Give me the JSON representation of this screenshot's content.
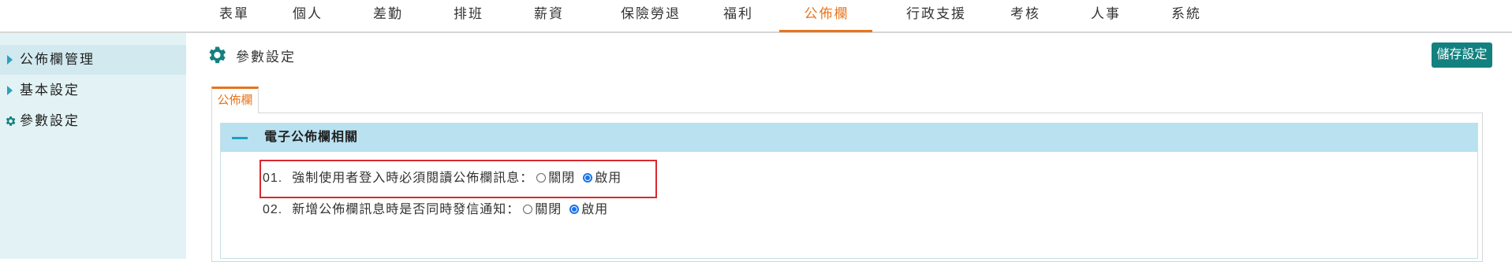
{
  "nav": {
    "items": [
      "表單",
      "個人",
      "差勤",
      "排班",
      "薪資",
      "保險勞退",
      "福利",
      "公佈欄",
      "行政支援",
      "考核",
      "人事",
      "系統"
    ],
    "active": "公佈欄"
  },
  "sidebar": {
    "items": [
      {
        "label": "公佈欄管理",
        "icon": "triangle-right-icon"
      },
      {
        "label": "基本設定",
        "icon": "triangle-right-icon"
      },
      {
        "label": "參數設定",
        "icon": "gear-icon"
      }
    ]
  },
  "page": {
    "title": "參數設定",
    "title_icon": "gear-icon",
    "save_label": "儲存設定"
  },
  "tabs": [
    {
      "label": "公佈欄"
    }
  ],
  "section": {
    "title": "電子公佈欄相關",
    "settings": [
      {
        "num": "01.",
        "label": "強制使用者登入時必須閱讀公佈欄訊息：",
        "off": "關閉",
        "on": "啟用",
        "value": "啟用"
      },
      {
        "num": "02.",
        "label": "新增公佈欄訊息時是否同時發信通知：",
        "off": "關閉",
        "on": "啟用",
        "value": "啟用"
      }
    ]
  },
  "colors": {
    "accent": "#e8741c",
    "save_button": "#12817f",
    "sidebar_bg": "#e3f3f5",
    "section_header": "#b9e1f0",
    "highlight": "#d9282f"
  }
}
